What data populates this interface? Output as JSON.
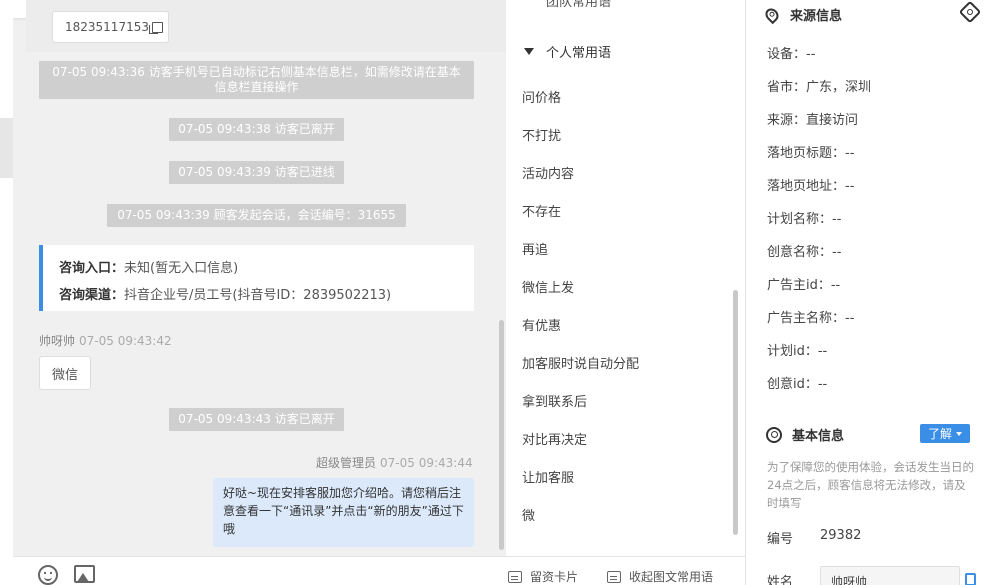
{
  "chat": {
    "phone_number": "18235117153",
    "system_messages": [
      "07-05 09:43:36 访客手机号已自动标记右侧基本信息栏，如需修改请在基本信息栏直接操作",
      "07-05 09:43:38 访客已离开",
      "07-05 09:43:39 访客已进线",
      "07-05 09:43:39 顾客发起会话，会话编号：31655",
      "07-05 09:43:43 访客已离开"
    ],
    "info_box": {
      "entry_label": "咨询入口：",
      "entry_value": "未知(暂无入口信息)",
      "channel_label": "咨询渠道：",
      "channel_value": "抖音企业号/员工号(抖音号ID：2839502213)"
    },
    "visitor_name": "帅呀帅",
    "visitor_time": "07-05 09:43:42",
    "visitor_message": "微信",
    "admin_name": "超级管理员",
    "admin_time": "07-05 09:43:44",
    "admin_message": "好哒~现在安排客服加您介绍哈。请您稍后注意查看一下“通讯录”并点击“新的朋友”通过下哦"
  },
  "toolbar": {
    "emoji_icon": "smile-icon",
    "image_icon": "image-icon",
    "card_label": "留资卡片",
    "collapse_label": "收起图文常用语"
  },
  "phrases": {
    "top_partial": "团队常用语",
    "section_title": "个人常用语",
    "items": [
      "问价格",
      "不打扰",
      "活动内容",
      "不存在",
      "再追",
      "微信上发",
      "有优惠",
      "加客服时说自动分配",
      "拿到联系后",
      "对比再决定",
      "让加客服",
      "微"
    ]
  },
  "source_info": {
    "title": "来源信息",
    "fields": [
      "设备：--",
      "省市：广东，深圳",
      "来源：直接访问",
      "落地页标题：--",
      "落地页地址：--",
      "计划名称：--",
      "创意名称：--",
      "广告主id：--",
      "广告主名称：--",
      "计划id：--",
      "创意id：--"
    ]
  },
  "basic_info": {
    "title": "基本信息",
    "learn_label": "了解",
    "note": "为了保障您的使用体验，会话发生当日的24点之后，顾客信息将无法修改，请及时填写",
    "id_label": "编号",
    "id_value": "29382",
    "name_label": "姓名",
    "name_value": "帅呀帅"
  },
  "colors": {
    "accent": "#3a8ee6",
    "admin_bubble": "#dbe9fb",
    "system_bubble": "#cfcfcf"
  }
}
